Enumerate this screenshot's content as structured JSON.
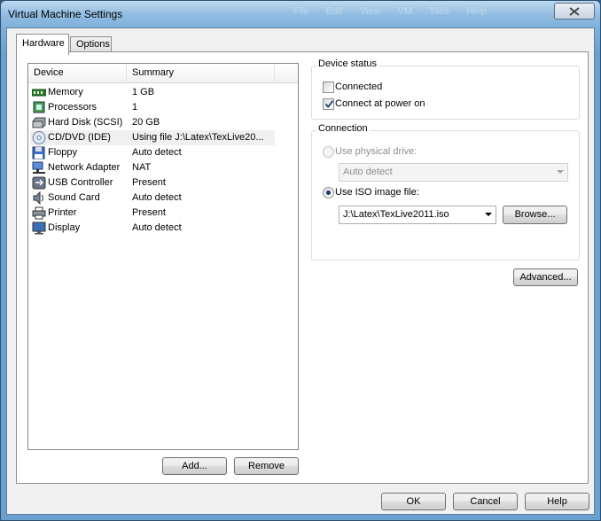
{
  "window": {
    "title": "Virtual Machine Settings",
    "background_menu": [
      "File",
      "Edit",
      "View",
      "VM",
      "Tabs",
      "Help"
    ]
  },
  "tabs": [
    {
      "label": "Hardware",
      "active": true
    },
    {
      "label": "Options",
      "active": false
    }
  ],
  "device_list": {
    "columns": {
      "device": "Device",
      "summary": "Summary"
    },
    "rows": [
      {
        "name": "Memory",
        "summary": "1 GB",
        "icon": "memory-icon"
      },
      {
        "name": "Processors",
        "summary": "1",
        "icon": "processor-icon"
      },
      {
        "name": "Hard Disk (SCSI)",
        "summary": "20 GB",
        "icon": "hard-disk-icon"
      },
      {
        "name": "CD/DVD (IDE)",
        "summary": "Using file J:\\Latex\\TexLive20...",
        "icon": "cd-dvd-icon",
        "selected": true
      },
      {
        "name": "Floppy",
        "summary": "Auto detect",
        "icon": "floppy-icon"
      },
      {
        "name": "Network Adapter",
        "summary": "NAT",
        "icon": "network-adapter-icon"
      },
      {
        "name": "USB Controller",
        "summary": "Present",
        "icon": "usb-icon"
      },
      {
        "name": "Sound Card",
        "summary": "Auto detect",
        "icon": "sound-card-icon"
      },
      {
        "name": "Printer",
        "summary": "Present",
        "icon": "printer-icon"
      },
      {
        "name": "Display",
        "summary": "Auto detect",
        "icon": "display-icon"
      }
    ],
    "add_label": "Add...",
    "remove_label": "Remove"
  },
  "device_status": {
    "title": "Device status",
    "connected_label": "Connected",
    "connected_checked": false,
    "connect_at_power_on_label": "Connect at power on",
    "connect_at_power_on_checked": true
  },
  "connection": {
    "title": "Connection",
    "physical_label": "Use physical drive:",
    "physical_value": "Auto detect",
    "iso_label": "Use ISO image file:",
    "iso_value": "J:\\Latex\\TexLive2011.iso",
    "browse_label": "Browse...",
    "selected": "iso"
  },
  "advanced_label": "Advanced...",
  "footer": {
    "ok_label": "OK",
    "cancel_label": "Cancel",
    "help_label": "Help"
  },
  "colors": {
    "titlebar": "#93bde2",
    "dialog_bg": "#f0f0f0",
    "radio_dot": "#1b3a73"
  }
}
